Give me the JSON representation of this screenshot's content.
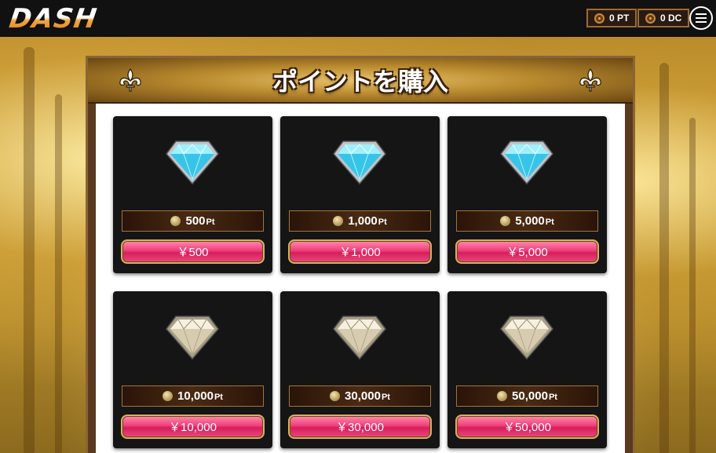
{
  "header": {
    "logo": "DASH",
    "wallet_pt": "0 PT",
    "wallet_dc": "0 DC"
  },
  "panel": {
    "title": "ポイントを購入"
  },
  "packages": [
    {
      "points": "500",
      "unit": "Pt",
      "price": "￥500",
      "gem": "blue-diamond-icon"
    },
    {
      "points": "1,000",
      "unit": "Pt",
      "price": "￥1,000",
      "gem": "blue-diamond-icon"
    },
    {
      "points": "5,000",
      "unit": "Pt",
      "price": "￥5,000",
      "gem": "blue-diamond-icon"
    },
    {
      "points": "10,000",
      "unit": "Pt",
      "price": "￥10,000",
      "gem": "white-diamond-icon"
    },
    {
      "points": "30,000",
      "unit": "Pt",
      "price": "￥30,000",
      "gem": "white-diamond-icon"
    },
    {
      "points": "50,000",
      "unit": "Pt",
      "price": "￥50,000",
      "gem": "white-diamond-icon"
    }
  ],
  "colors": {
    "accent_pink": "#e8497c",
    "frame_gold": "#d9b060",
    "card_bg": "#151515"
  }
}
